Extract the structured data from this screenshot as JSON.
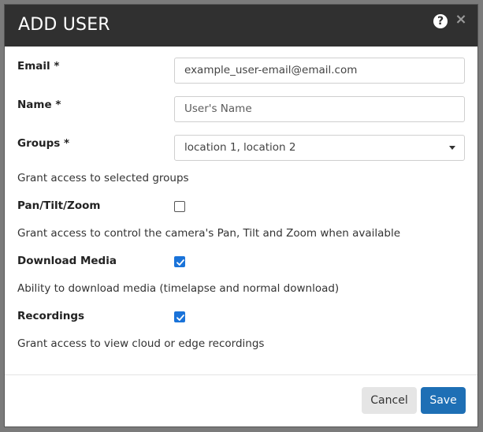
{
  "modal": {
    "title": "ADD USER",
    "help_icon": "?",
    "close_icon": "×"
  },
  "form": {
    "email": {
      "label": "Email *",
      "value": "example_user-email@email.com"
    },
    "name": {
      "label": "Name *",
      "placeholder": "User's Name"
    },
    "groups": {
      "label": "Groups *",
      "selected": "location 1, location 2",
      "hint": "Grant access to selected groups"
    },
    "ptz": {
      "label": "Pan/Tilt/Zoom",
      "checked": false,
      "hint": "Grant access to control the camera's Pan, Tilt and Zoom when available"
    },
    "download_media": {
      "label": "Download Media",
      "checked": true,
      "hint": "Ability to download media (timelapse and normal download)"
    },
    "recordings": {
      "label": "Recordings",
      "checked": true,
      "hint": "Grant access to view cloud or edge recordings"
    }
  },
  "footer": {
    "cancel_label": "Cancel",
    "save_label": "Save"
  },
  "colors": {
    "header_bg": "#303030",
    "primary": "#1e6fb5",
    "checkbox_checked": "#1a73d9"
  }
}
